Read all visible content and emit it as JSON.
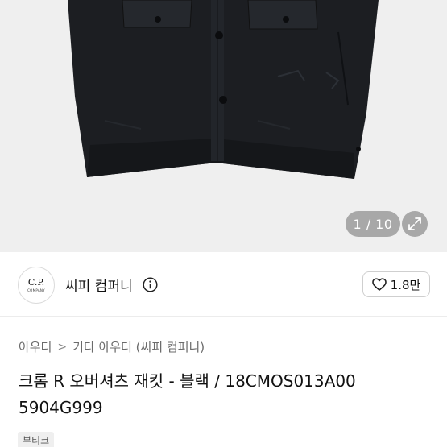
{
  "gallery": {
    "counter": "1 / 10",
    "image": "black cropped overshirt jacket product photo"
  },
  "seller": {
    "logo_main": "C.P.",
    "logo_sub": "COMPANY",
    "name": "씨피 컴퍼니",
    "likes": "1.8만"
  },
  "breadcrumb": [
    "아우터",
    "기타 아우터 (씨피 컴퍼니)"
  ],
  "product": {
    "title": "크롬 R 오버셔츠 재킷 - 블랙 / 18CMOS013A00 5904G999",
    "tag": "부티크"
  },
  "icons": {
    "expand": "expand-arrows-icon",
    "info": "info-icon",
    "heart": "heart-outline-icon",
    "chevron": "chevron-right-icon"
  }
}
